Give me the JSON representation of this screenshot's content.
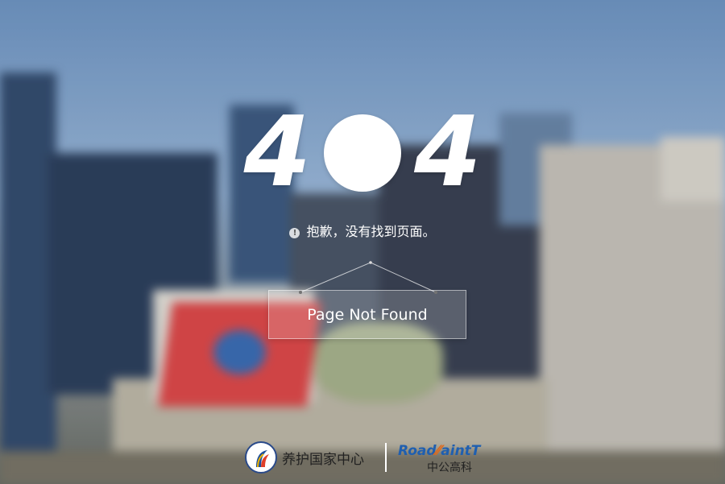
{
  "hero": {
    "digit_left": "4",
    "digit_right": "4"
  },
  "message": {
    "info_icon": "info-icon",
    "text": "抱歉，没有找到页面。"
  },
  "sign": {
    "label": "Page Not Found"
  },
  "footer": {
    "org_left": "养护国家中心",
    "brand_part1": "Road",
    "brand_part2": "aint",
    "brand_part3": "T",
    "org_right": "中公高科"
  }
}
